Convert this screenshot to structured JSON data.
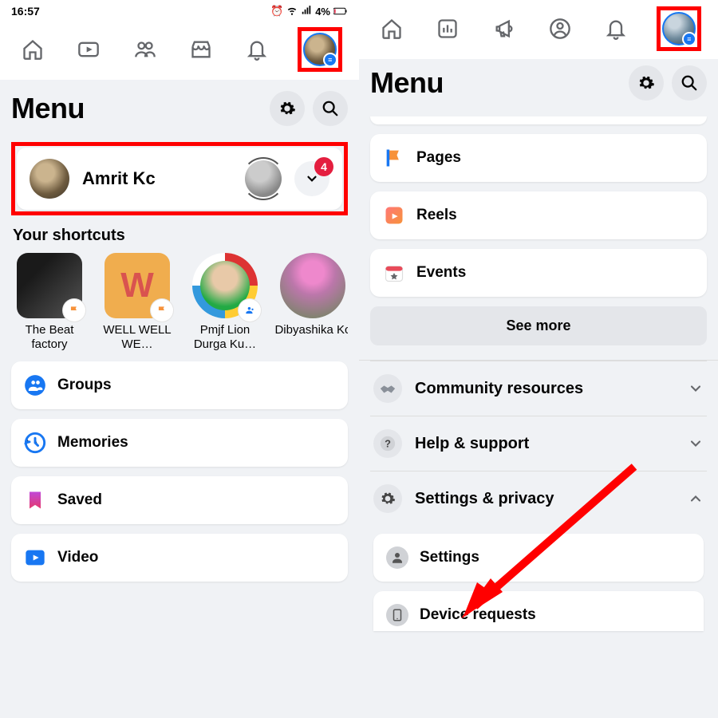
{
  "status": {
    "time": "16:57",
    "battery": "4%"
  },
  "menu_title": "Menu",
  "profile": {
    "name": "Amrit Kc",
    "notif_count": "4"
  },
  "shortcuts_label": "Your shortcuts",
  "shortcuts": [
    {
      "label": "The Beat factory",
      "w": ""
    },
    {
      "label": "WELL WELL WE…",
      "w": "W"
    },
    {
      "label": "Pmjf Lion Durga Ku…"
    },
    {
      "label": "Dibyashika Kc"
    }
  ],
  "left_items": [
    {
      "label": "Groups"
    },
    {
      "label": "Memories"
    },
    {
      "label": "Saved"
    },
    {
      "label": "Video"
    }
  ],
  "right_items": [
    {
      "label": "Pages"
    },
    {
      "label": "Reels"
    },
    {
      "label": "Events"
    }
  ],
  "see_more": "See more",
  "expandable": [
    {
      "label": "Community resources",
      "open": false
    },
    {
      "label": "Help & support",
      "open": false
    },
    {
      "label": "Settings & privacy",
      "open": true
    }
  ],
  "sub_items": [
    {
      "label": "Settings"
    },
    {
      "label": "Device requests"
    }
  ],
  "colors": {
    "red": "#ff0000",
    "fb_blue": "#1877f2",
    "badge_red": "#e41e3f"
  }
}
